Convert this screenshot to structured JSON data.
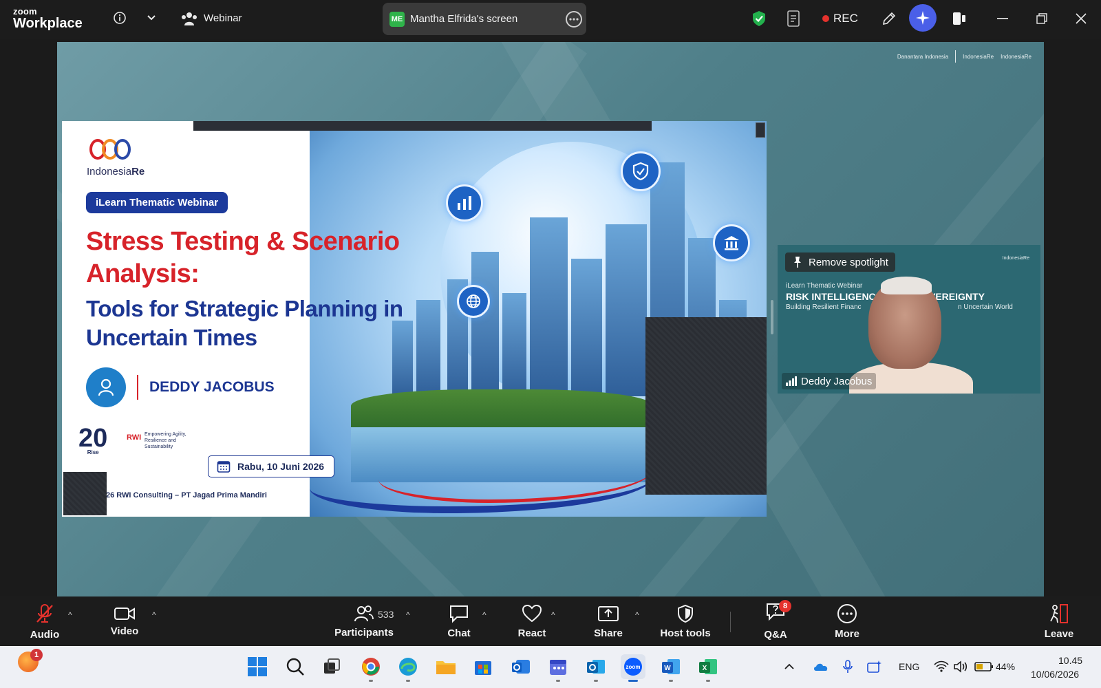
{
  "app": {
    "brand_small": "zoom",
    "brand_big": "Workplace",
    "meeting_type": "Webinar",
    "share_initials": "ME",
    "share_label": "Mantha Elfrida's screen",
    "rec_label": "REC"
  },
  "stage": {
    "logo_left": "Danantara Indonesia",
    "logo_mid": "IndonesiaRe",
    "logo_right": "IndonesiaRe"
  },
  "slide": {
    "logo_name_plain": "Indonesia",
    "logo_name_bold": "Re",
    "badge": "iLearn Thematic Webinar",
    "title_red": "Stress Testing & Scenario Analysis:",
    "title_blue": "Tools for Strategic Planning in Uncertain Times",
    "speaker": "DEDDY JACOBUS",
    "date": "Rabu, 10 Juni 2026",
    "footer": "26 RWI Consulting – PT Jagad Prima Mandiri",
    "anniversary": "20",
    "anniversary_sub": "Rise",
    "rwi_tag": "RWI",
    "rwi_tagline": "Empowering Agility, Resilience and Sustainability"
  },
  "spotlight": {
    "remove_label": "Remove spotlight",
    "line1": "iLearn Thematic Webinar",
    "line2a": "RISK INTELLIGENC",
    "line2b": "VEREIGNTY",
    "line3a": "Building Resilient Financ",
    "line3b": "n Uncertain World",
    "mini_logo": "IndonesiaRe",
    "speaker_name": "Deddy Jacobus"
  },
  "toolbar": {
    "audio": "Audio",
    "video": "Video",
    "participants": "Participants",
    "participants_count": "533",
    "chat": "Chat",
    "react": "React",
    "share": "Share",
    "host_tools": "Host tools",
    "qa": "Q&A",
    "qa_count": "8",
    "more": "More",
    "leave": "Leave"
  },
  "taskbar": {
    "notif_count": "1",
    "lang": "ENG",
    "battery": "44%",
    "time": "10.45",
    "date": "10/06/2026"
  },
  "colors": {
    "zoom_blue": "#0b5cff",
    "rec_red": "#e5322d",
    "slide_red": "#d7232a",
    "slide_blue": "#1c3692",
    "ai_purple": "#4a5fe8"
  }
}
